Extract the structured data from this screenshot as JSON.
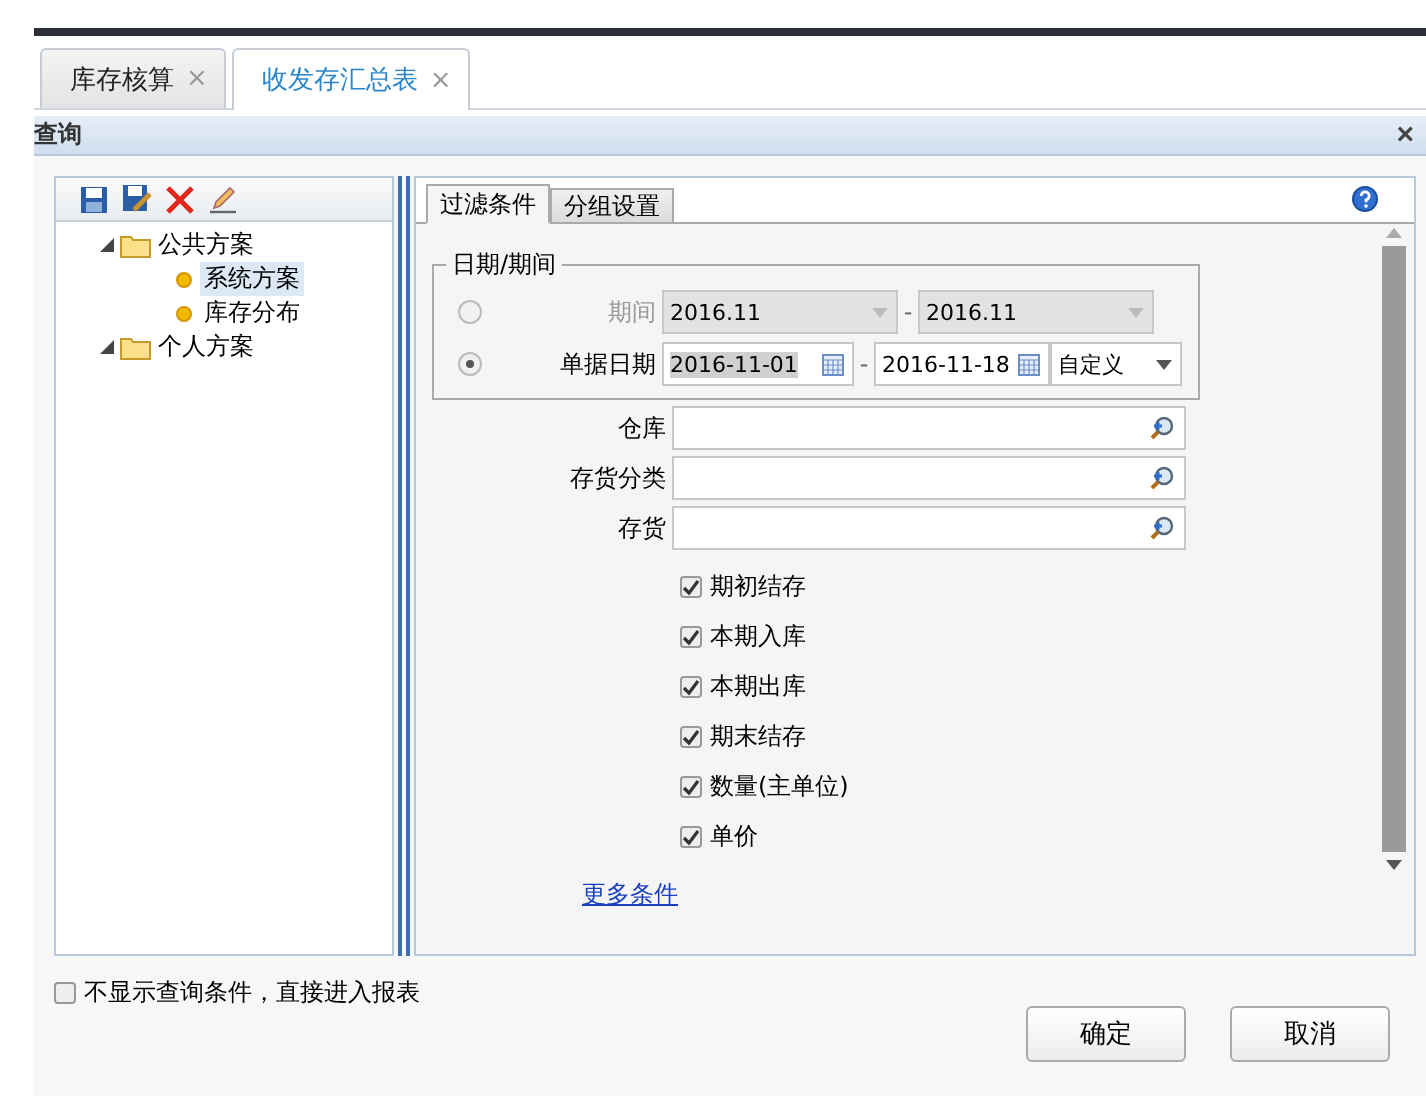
{
  "tabs": [
    {
      "label": "库存核算",
      "selected": false,
      "close": "×"
    },
    {
      "label": "收发存汇总表",
      "selected": true,
      "close": "×"
    }
  ],
  "dialog": {
    "title": "查询",
    "close": "×"
  },
  "scheme_tree": [
    {
      "label": "公共方案",
      "expanded": true,
      "children": [
        {
          "label": "系统方案",
          "selected": true
        },
        {
          "label": "库存分布",
          "selected": false
        }
      ]
    },
    {
      "label": "个人方案",
      "expanded": true
    }
  ],
  "filter_tabs": [
    {
      "label": "过滤条件",
      "selected": true
    },
    {
      "label": "分组设置",
      "selected": false
    }
  ],
  "date_group": {
    "legend": "日期/期间",
    "rows": [
      {
        "kind": "period",
        "selected": false,
        "disabled": true,
        "label": "期间",
        "from": "2016.11",
        "separator": "-",
        "to": "2016.11"
      },
      {
        "kind": "date",
        "selected": true,
        "disabled": false,
        "label": "单据日期",
        "from": "2016-11-01",
        "separator": "-",
        "to": "2016-11-18",
        "range": "自定义"
      }
    ]
  },
  "fields": [
    {
      "label": "仓库"
    },
    {
      "label": "存货分类"
    },
    {
      "label": "存货"
    }
  ],
  "options": [
    {
      "label": "期初结存",
      "checked": true
    },
    {
      "label": "本期入库",
      "checked": true
    },
    {
      "label": "本期出库",
      "checked": true
    },
    {
      "label": "期末结存",
      "checked": true
    },
    {
      "label": "数量(主单位)",
      "checked": true
    },
    {
      "label": "单价",
      "checked": true
    }
  ],
  "more_link": "更多条件",
  "skip_option": {
    "label": "不显示查询条件，直接进入报表",
    "checked": false
  },
  "buttons": [
    "确定",
    "取消"
  ]
}
